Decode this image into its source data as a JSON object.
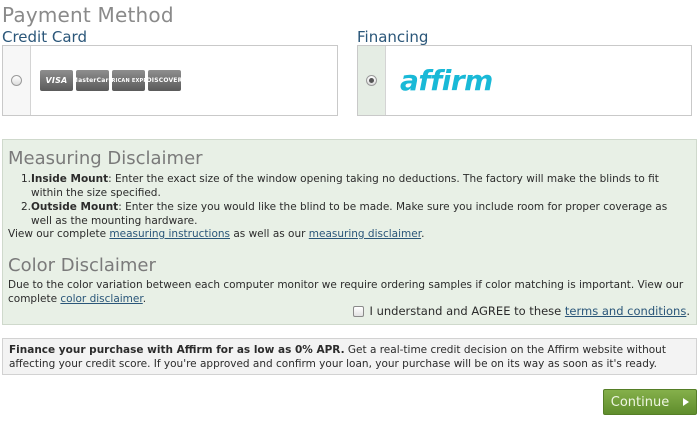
{
  "page": {
    "title": "Payment Method"
  },
  "payment": {
    "credit_card": {
      "label": "Credit Card",
      "selected": false,
      "cards": [
        "VISA",
        "MasterCard",
        "AMERICAN EXPRESS",
        "DISCOVER"
      ]
    },
    "financing": {
      "label": "Financing",
      "selected": true,
      "provider_logo": "affirm"
    }
  },
  "measuring": {
    "heading": "Measuring Disclaimer",
    "items": [
      {
        "num": "1.",
        "title": "Inside Mount",
        "text": ": Enter the exact size of the window opening taking no deductions. The factory will make the blinds to fit within the size specified."
      },
      {
        "num": "2.",
        "title": "Outside Mount",
        "text": ": Enter the size you would like the blind to be made. Make sure you include room for proper coverage as well as the mounting hardware."
      }
    ],
    "view_prefix": "View our complete ",
    "link_instructions": "measuring instructions",
    "view_middle": " as well as our ",
    "link_disclaimer": "measuring disclaimer",
    "view_suffix": "."
  },
  "color": {
    "heading": "Color Disclaimer",
    "text": "Due to the color variation between each computer monitor we require ordering samples if color matching is important. View our complete ",
    "link": "color disclaimer",
    "suffix": "."
  },
  "agreement": {
    "checked": false,
    "label": "I understand and AGREE to these ",
    "link": "terms and conditions",
    "suffix": "."
  },
  "finance_note": {
    "bold": "Finance your purchase with Affirm for as low as 0% APR.",
    "text": " Get a real-time credit decision on the Affirm website without affecting your credit score. If you're approved and confirm your loan, your purchase will be on its way as soon as it's ready."
  },
  "continue_label": "Continue",
  "colors": {
    "link": "#2a5679",
    "panel": "#e8f0e6",
    "button": "#6f9e3a",
    "affirm": "#19b9d7"
  }
}
